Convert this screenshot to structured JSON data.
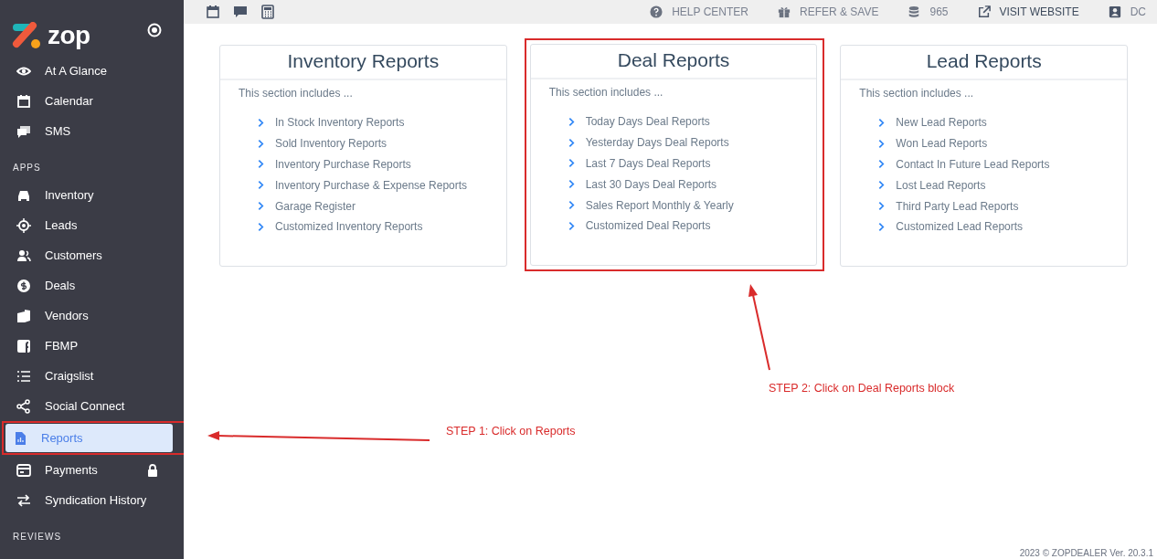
{
  "sidebar": {
    "logo": "zop",
    "sections": [
      {
        "items": [
          {
            "label": "At A Glance",
            "selected": false,
            "highlighted": false
          },
          {
            "label": "Calendar",
            "selected": false,
            "highlighted": false
          },
          {
            "label": "SMS",
            "selected": false,
            "highlighted": false
          }
        ]
      },
      {
        "label": "APPS",
        "items": [
          {
            "label": "Inventory",
            "selected": false,
            "highlighted": false
          },
          {
            "label": "Leads",
            "selected": false,
            "highlighted": false
          },
          {
            "label": "Customers",
            "selected": false,
            "highlighted": false
          },
          {
            "label": "Deals",
            "selected": false,
            "highlighted": false
          },
          {
            "label": "Vendors",
            "selected": false,
            "highlighted": false
          },
          {
            "label": "FBMP",
            "selected": false,
            "highlighted": false
          },
          {
            "label": "Craigslist",
            "selected": false,
            "highlighted": false
          },
          {
            "label": "Social Connect",
            "selected": false,
            "highlighted": false
          },
          {
            "label": "Reports",
            "selected": true,
            "highlighted": true
          },
          {
            "label": "Payments",
            "selected": false,
            "highlighted": false,
            "locked": true
          },
          {
            "label": "Syndication History",
            "selected": false,
            "highlighted": false
          }
        ]
      },
      {
        "label": "REVIEWS"
      }
    ]
  },
  "topbar": {
    "links": [
      {
        "label": "HELP CENTER",
        "emphasized": false
      },
      {
        "label": "REFER & SAVE",
        "emphasized": false
      },
      {
        "label": "965",
        "emphasized": false
      },
      {
        "label": "VISIT WEBSITE",
        "emphasized": true
      },
      {
        "label": "DC",
        "emphasized": false
      }
    ]
  },
  "cards": [
    {
      "title": "Inventory Reports",
      "intro": "This section includes ...",
      "highlighted": false,
      "items": [
        "In Stock Inventory Reports",
        "Sold Inventory Reports",
        "Inventory Purchase Reports",
        "Inventory Purchase & Expense Reports",
        "Garage Register",
        "Customized Inventory Reports"
      ]
    },
    {
      "title": "Deal Reports",
      "intro": "This section includes ...",
      "highlighted": true,
      "items": [
        "Today Days Deal Reports",
        "Yesterday Days Deal Reports",
        "Last 7 Days Deal Reports",
        "Last 30 Days Deal Reports",
        "Sales Report Monthly & Yearly",
        "Customized Deal Reports"
      ]
    },
    {
      "title": "Lead Reports",
      "intro": "This section includes ...",
      "highlighted": false,
      "items": [
        "New Lead Reports",
        "Won Lead Reports",
        "Contact In Future Lead Reports",
        "Lost Lead Reports",
        "Third Party Lead Reports",
        "Customized Lead Reports"
      ]
    }
  ],
  "annotations": [
    {
      "text": "STEP 1: Click on Reports"
    },
    {
      "text": "STEP 2: Click on Deal Reports block"
    }
  ],
  "footer": "2023 © ZOPDEALER Ver. 20.3.1"
}
